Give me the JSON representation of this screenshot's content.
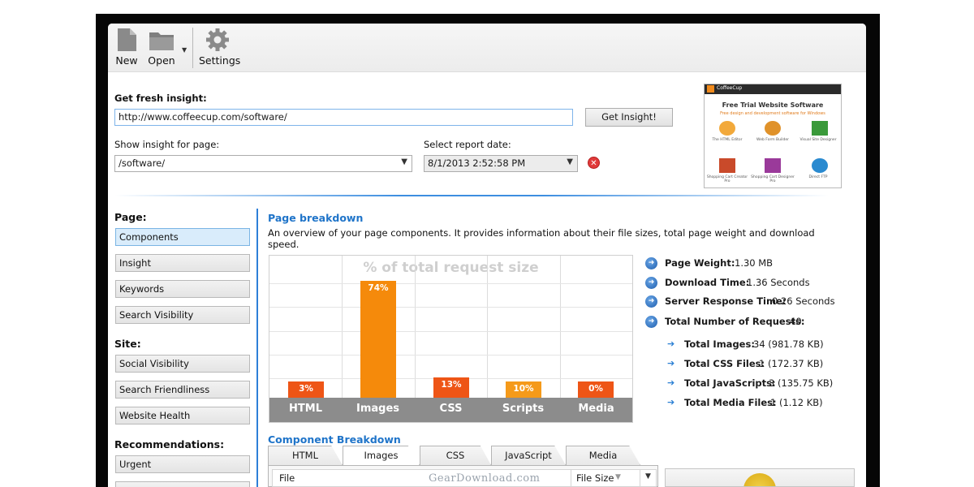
{
  "toolbar": {
    "new_label": "New",
    "open_label": "Open",
    "settings_label": "Settings"
  },
  "insight": {
    "heading": "Get fresh insight:",
    "url_value": "http://www.coffeecup.com/software/",
    "button_label": "Get Insight!",
    "page_label": "Show insight for page:",
    "page_value": "/software/",
    "date_label": "Select report date:",
    "date_value": "8/1/2013 2:52:58 PM"
  },
  "thumbnail": {
    "brand": "CoffeeCup",
    "headline": "Free Trial Website Software",
    "subline": "Free design and development software for Windows",
    "products": [
      "The HTML Editor",
      "Web Form Builder",
      "Visual Site Designer",
      "Shopping Cart Creator Pro",
      "Shopping Cart Designer Pro",
      "Direct FTP"
    ]
  },
  "sidebar": {
    "page_heading": "Page:",
    "page_items": [
      "Components",
      "Insight",
      "Keywords",
      "Search Visibility"
    ],
    "site_heading": "Site:",
    "site_items": [
      "Social Visibility",
      "Search Friendliness",
      "Website Health"
    ],
    "rec_heading": "Recommendations:",
    "rec_items": [
      "Urgent"
    ]
  },
  "breakdown": {
    "title": "Page breakdown",
    "description": "An overview of your page components. It provides information about their file sizes, total page weight and download speed."
  },
  "chart_data": {
    "type": "bar",
    "title": "% of total request size",
    "categories": [
      "HTML",
      "Images",
      "CSS",
      "Scripts",
      "Media"
    ],
    "values": [
      3,
      74,
      13,
      10,
      0
    ],
    "value_labels": [
      "3%",
      "74%",
      "13%",
      "10%",
      "0%"
    ],
    "colors": [
      "#ee5516",
      "#f58a0b",
      "#ee5516",
      "#f59a1a",
      "#ee5516"
    ],
    "ylim": [
      0,
      100
    ],
    "grid": true
  },
  "stats": {
    "page_weight_label": "Page Weight:",
    "page_weight_value": "1.30 MB",
    "download_time_label": "Download Time:",
    "download_time_value": "1.36 Seconds",
    "server_response_label": "Server Response Time:",
    "server_response_value": "0.26 Seconds",
    "total_requests_label": "Total Number of Requests:",
    "total_requests_value": "40",
    "total_images_label": "Total Images:",
    "total_images_value": "34 (981.78 KB)",
    "total_css_label": "Total CSS Files:",
    "total_css_value": "1 (172.37 KB)",
    "total_js_label": "Total JavaScripts:",
    "total_js_value": "3 (135.75 KB)",
    "total_media_label": "Total Media Files:",
    "total_media_value": "1 (1.12 KB)"
  },
  "component_breakdown": {
    "title": "Component Breakdown",
    "tabs": [
      "HTML",
      "Images",
      "CSS",
      "JavaScript",
      "Media"
    ],
    "active_tab": "Images",
    "col_file": "File",
    "col_size": "File Size"
  },
  "watermark": "GearDownload.com",
  "icons": {
    "new": "document-icon",
    "open": "folder-icon",
    "settings": "gear-icon",
    "delete": "delete-icon",
    "stat": "circle-arrow-icon",
    "substat": "arrow-right-icon"
  }
}
